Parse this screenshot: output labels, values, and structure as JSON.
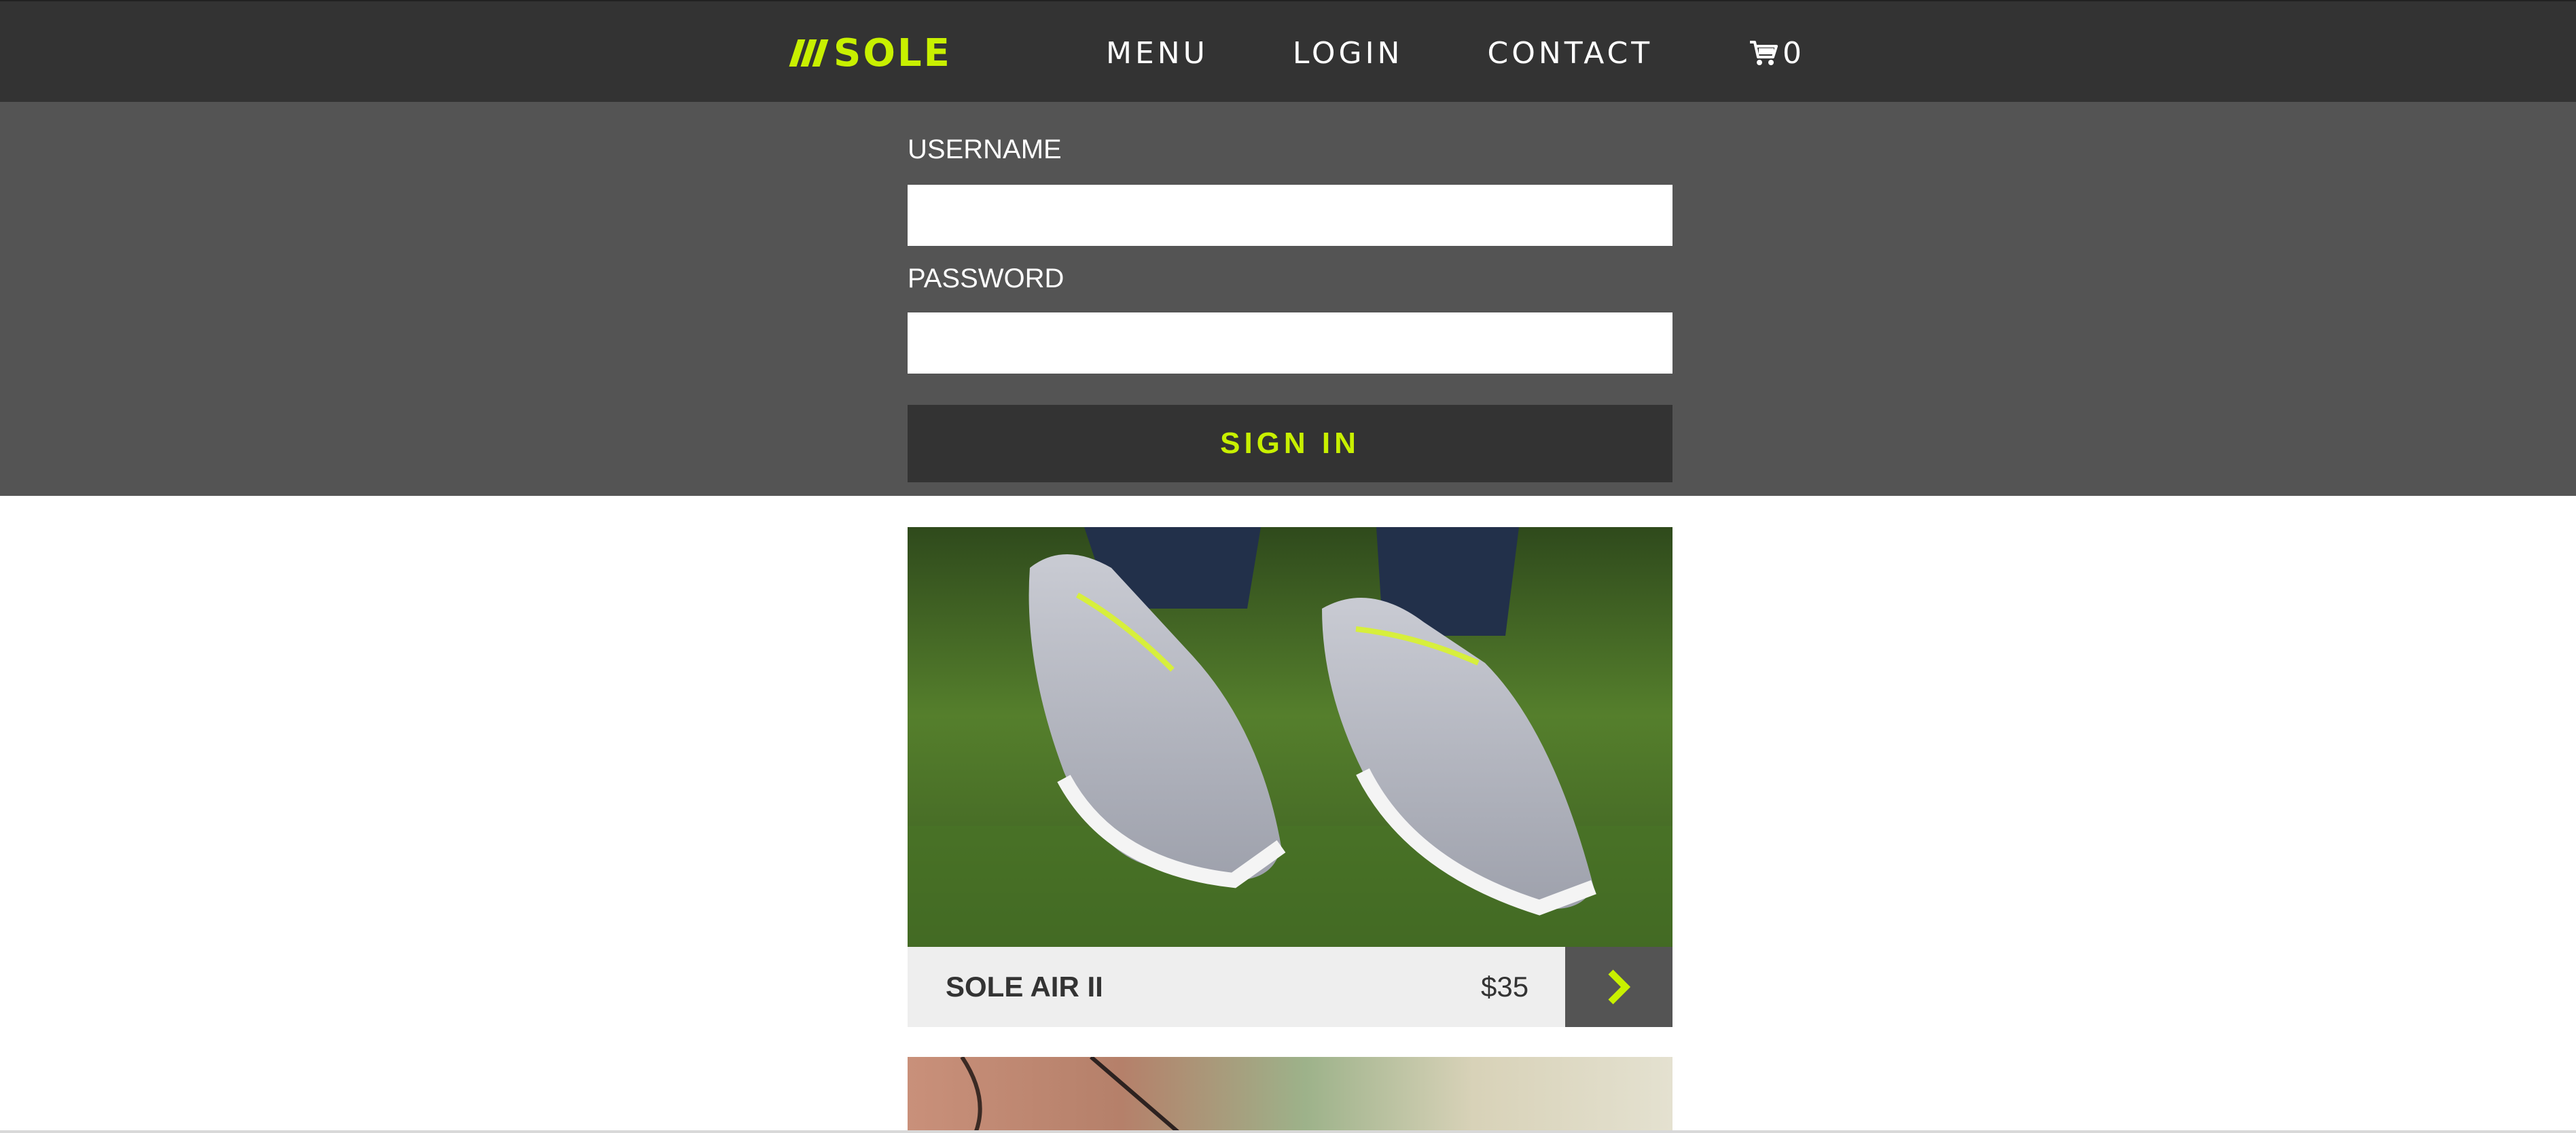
{
  "brand": {
    "name": "SOLE",
    "accent_color": "#c8f000"
  },
  "nav": {
    "items": [
      "MENU",
      "LOGIN",
      "CONTACT"
    ]
  },
  "cart": {
    "icon": "cart-icon",
    "count": "0"
  },
  "login": {
    "username_label": "USERNAME",
    "username_value": "",
    "password_label": "PASSWORD",
    "password_value": "",
    "submit_label": "SIGN IN"
  },
  "products": [
    {
      "name": "SOLE AIR II",
      "price": "$35",
      "action_icon": "chevron-right-icon"
    }
  ]
}
